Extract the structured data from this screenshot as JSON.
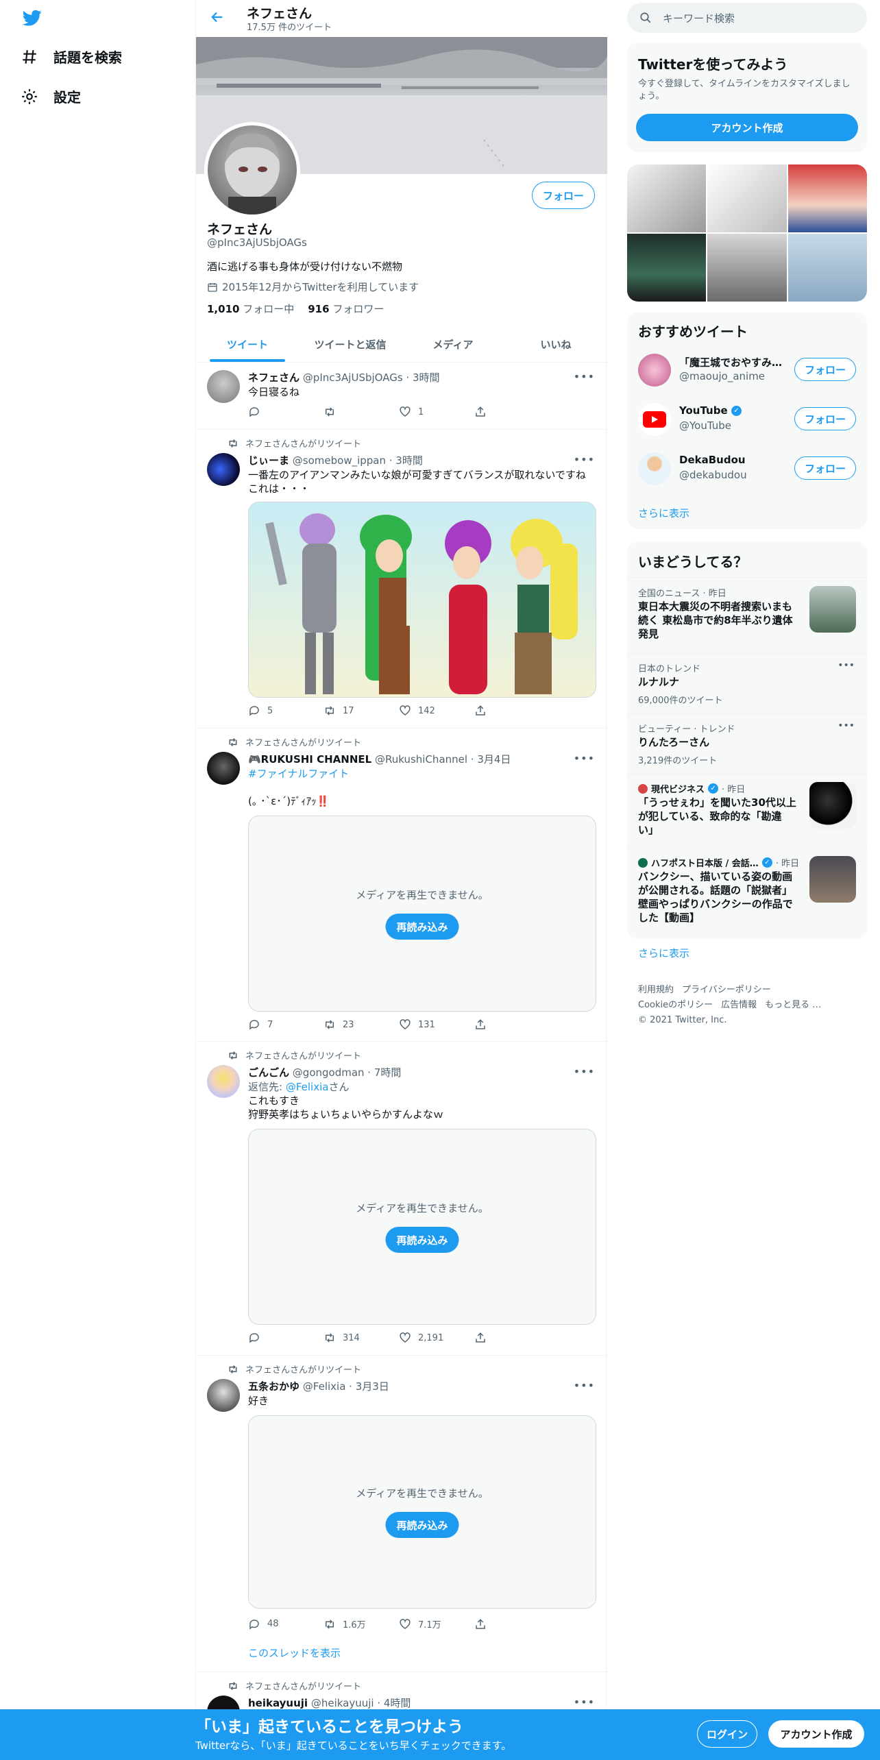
{
  "nav": {
    "explore": "話題を検索",
    "settings": "設定"
  },
  "profile_header": {
    "name": "ネフェさん",
    "tweet_count": "17.5万 件のツイート"
  },
  "profile": {
    "name": "ネフェさん",
    "handle": "@pInc3AjUSbjOAGs",
    "bio": "酒に逃げる事も身体が受け付けない不燃物",
    "joined": "2015年12月からTwitterを利用しています",
    "following_count": "1,010",
    "following_label": "フォロー中",
    "followers_count": "916",
    "followers_label": "フォロワー",
    "follow_label": "フォロー"
  },
  "tabs": [
    "ツイート",
    "ツイートと返信",
    "メディア",
    "いいね"
  ],
  "media_error": "メディアを再生できません。",
  "reload_label": "再読み込み",
  "tweets": [
    {
      "retweeted_by": "",
      "name": "ネフェさん",
      "meta": "@pInc3AjUSbjOAGs · 3時間",
      "text": "今日寝るね",
      "reply": "",
      "retweet": "",
      "like": "1"
    },
    {
      "retweeted_by": "ネフェさんさんがリツイート",
      "name": "じぃーま",
      "meta": "@somebow_ippan · 3時間",
      "text": "一番左のアイアンマンみたいな娘が可愛すぎてバランスが取れないですね\nこれは・・・",
      "reply": "5",
      "retweet": "17",
      "like": "142"
    },
    {
      "retweeted_by": "ネフェさんさんがリツイート",
      "name": "🎮RUKUSHI CHANNEL",
      "meta": "@RukushiChannel · 3月4日",
      "hashtag": "#ファイナルファイト",
      "text": "(｡ ･`ε･´)ﾃﾞｨｱｯ‼️",
      "reply": "7",
      "retweet": "23",
      "like": "131"
    },
    {
      "retweeted_by": "ネフェさんさんがリツイート",
      "name": "ごんごん",
      "meta": "@gongodman · 7時間",
      "reply_to_prefix": "返信先:",
      "reply_to_handle": "@Felixia",
      "reply_to_suffix": "さん",
      "text": "これもすき\n狩野英孝はちょいちょいやらかすんよなｗ",
      "reply": "",
      "retweet": "314",
      "like": "2,191"
    },
    {
      "retweeted_by": "ネフェさんさんがリツイート",
      "name": "五条おかゆ",
      "meta": "@Felixia · 3月3日",
      "text": "好き",
      "reply": "48",
      "retweet": "1.6万",
      "like": "7.1万",
      "thread": "このスレッドを表示"
    },
    {
      "retweeted_by": "ネフェさんさんがリツイート",
      "name": "heikayuuji",
      "meta": "@heikayuuji · 4時間"
    }
  ],
  "search": {
    "placeholder": "キーワード検索"
  },
  "signup_card": {
    "title": "Twitterを使ってみよう",
    "desc": "今すぐ登録して、タイムラインをカスタマイズしましょう。",
    "button": "アカウント作成"
  },
  "recommended": {
    "title": "おすすめツイート",
    "users": [
      {
        "name": "「魔王城でおやすみ…",
        "handle": "@maoujo_anime",
        "verified": false
      },
      {
        "name": "YouTube",
        "handle": "@YouTube",
        "verified": true
      },
      {
        "name": "DekaBudou",
        "handle": "@dekabudou",
        "verified": false
      }
    ],
    "follow": "フォロー",
    "show_more": "さらに表示"
  },
  "trends": {
    "title": "いまどうしてる？",
    "items": [
      {
        "meta": "全国のニュース · 昨日",
        "title": "東日本大震災の不明者捜索いまも\n続く 東松島市で約8年半ぶり遺体\n発見",
        "sub": ""
      },
      {
        "meta": "日本のトレンド",
        "title": "ルナルナ",
        "sub": "69,000件のツイート"
      },
      {
        "meta": "ビューティー · トレンド",
        "title": "りんたろーさん",
        "sub": "3,219件のツイート"
      },
      {
        "meta_source": "現代ビジネス",
        "meta_time": "· 昨日",
        "title": "「うっせぇわ」を聞いた30代以上\nが犯している、致命的な「勘違\nい」",
        "sub": ""
      },
      {
        "meta_source": "ハフポスト日本版 / 会話…",
        "meta_time": "· 昨日",
        "title": "バンクシー、描いている姿の動画\nが公開される。話題の「説獄者」\n壁画やっぱりバンクシーの作品で\nした【動画】",
        "sub": ""
      }
    ],
    "show_more": "さらに表示"
  },
  "footer": {
    "links": [
      "利用規約",
      "プライバシーポリシー",
      "Cookieのポリシー",
      "広告情報",
      "もっと見る …"
    ],
    "copyright": "© 2021 Twitter, Inc."
  },
  "bottom_bar": {
    "title": "「いま」起きていることを見つけよう",
    "sub": "Twitterなら、「いま」起きていることをいち早くチェックできます。",
    "login": "ログイン",
    "signup": "アカウント作成"
  },
  "colors": {
    "accent": "#1d9bf0",
    "text": "#0f1419",
    "secondary": "#536471"
  }
}
